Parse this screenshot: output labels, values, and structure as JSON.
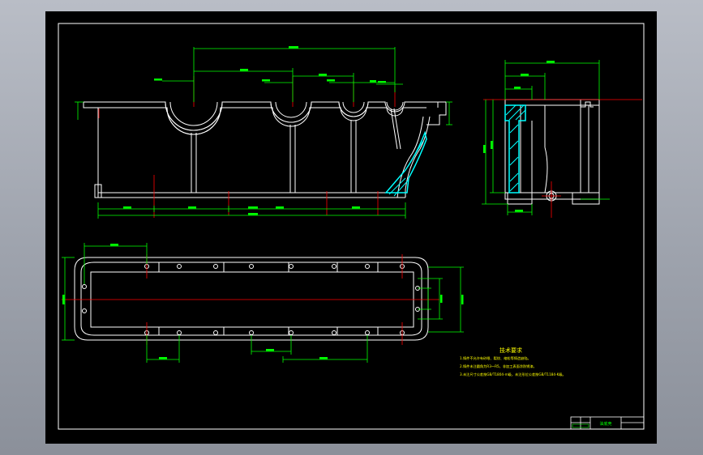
{
  "tech_requirements": {
    "title": "技术要求",
    "lines": [
      "1.铸件不允许有砂眼、裂纹、缩松等铸造缺陷。",
      "2.铸件未注圆角为R3～R5，非加工表面涂防锈漆。",
      "3.未注尺寸公差按GB/T1804-m级，未注形位公差按GB/T1184-K级。"
    ]
  },
  "title_block": {
    "name": "油底壳",
    "code": ""
  },
  "colors": {
    "background": "#000000",
    "outline": "#ffffff",
    "dimension": "#00ff00",
    "centerline": "#ff0000",
    "hatch": "#00ffff",
    "notes": "#ffff00"
  }
}
